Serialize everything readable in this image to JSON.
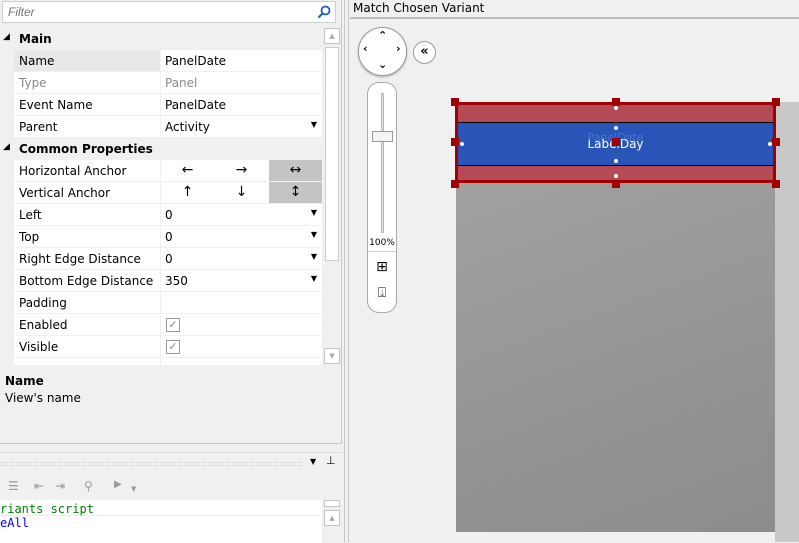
{
  "filter": {
    "placeholder": "Filter"
  },
  "properties": {
    "categories": [
      {
        "label": "Main"
      },
      {
        "label": "Common Properties"
      }
    ],
    "main": [
      {
        "name": "Name",
        "value": "PanelDate"
      },
      {
        "name": "Type",
        "value": "Panel"
      },
      {
        "name": "Event Name",
        "value": "PanelDate"
      },
      {
        "name": "Parent",
        "value": "Activity"
      }
    ],
    "common": [
      {
        "name": "Horizontal Anchor"
      },
      {
        "name": "Vertical Anchor"
      },
      {
        "name": "Left",
        "value": "0"
      },
      {
        "name": "Top",
        "value": "0"
      },
      {
        "name": "Right Edge Distance",
        "value": "0"
      },
      {
        "name": "Bottom Edge Distance",
        "value": "350"
      },
      {
        "name": "Padding",
        "value": ""
      },
      {
        "name": "Enabled",
        "checked": true
      },
      {
        "name": "Visible",
        "checked": true
      }
    ],
    "anchors": {
      "horizontal": [
        "←",
        "→",
        "↔"
      ],
      "vertical": [
        "↑",
        "↓",
        "↕"
      ]
    }
  },
  "description": {
    "title": "Name",
    "text": "View's name"
  },
  "code": {
    "line1": "riants script",
    "line2": "eAll",
    "comment_color": "#008000",
    "keyword_color": "#0000ff"
  },
  "designer": {
    "title": "Match Chosen Variant",
    "zoom": "100%",
    "zoom_level": 0.5,
    "label_text": "LabelDay",
    "ghost_text": "PanelDate",
    "panel_color": "#b44a55",
    "label_color": "#2a55b8",
    "selection_color": "#a00000"
  }
}
